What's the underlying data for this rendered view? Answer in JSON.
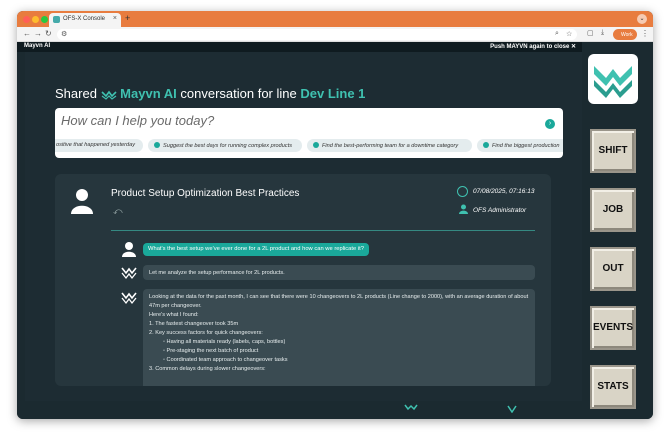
{
  "browser": {
    "tab_title": "OFS-X Console",
    "tab_close": "×",
    "new_tab": "+",
    "profile_label": "Work"
  },
  "modal": {
    "header_left": "Mayvn AI",
    "header_right": "Push MAYVN again to close ✕",
    "title_prefix": "Shared",
    "title_brand": "Mayvn AI",
    "title_middle": "conversation for line",
    "title_line": "Dev Line 1"
  },
  "search": {
    "placeholder": "How can I help you today?",
    "send_icon": "chevron-right-icon"
  },
  "suggestions": [
    "ositive that happened yesterday",
    "Suggest the best days for running complex products",
    "Find the best-performing team for a downtime category",
    "Find the biggest production"
  ],
  "conversation": {
    "title": "Product Setup Optimization Best Practices",
    "date": "07/08/2025, 07:16:13",
    "author": "OFS Administrator",
    "user_question": "What's the best setup we've ever done for a 2L product and how can we replicate it?",
    "ai_intro": "Let me analyze the setup performance for 2L products.",
    "ai_answer": {
      "p1": "Looking at the data for the past month, I can see that there were 10 changeovers to 2L products (Line change to 2000), with an average duration of about 47m per changeover.",
      "p2": "Here's what I found:",
      "item1": "1. The fastest changeover took 35m",
      "item2": "2. Key success factors for quick changeovers:",
      "sub1": "Having all materials ready (labels, caps, bottles)",
      "sub2": "Pre-staging the next batch of product",
      "sub3": "Coordinated team approach to changeover tasks",
      "item3": "3. Common delays during slower changeovers:"
    }
  },
  "sidebar": {
    "buttons": [
      "SHIFT",
      "JOB",
      "OUT",
      "EVENTS",
      "STATS"
    ]
  },
  "colors": {
    "accent": "#3fc1b0",
    "background": "#1d2c33",
    "browser_bar": "#e87c3f"
  }
}
